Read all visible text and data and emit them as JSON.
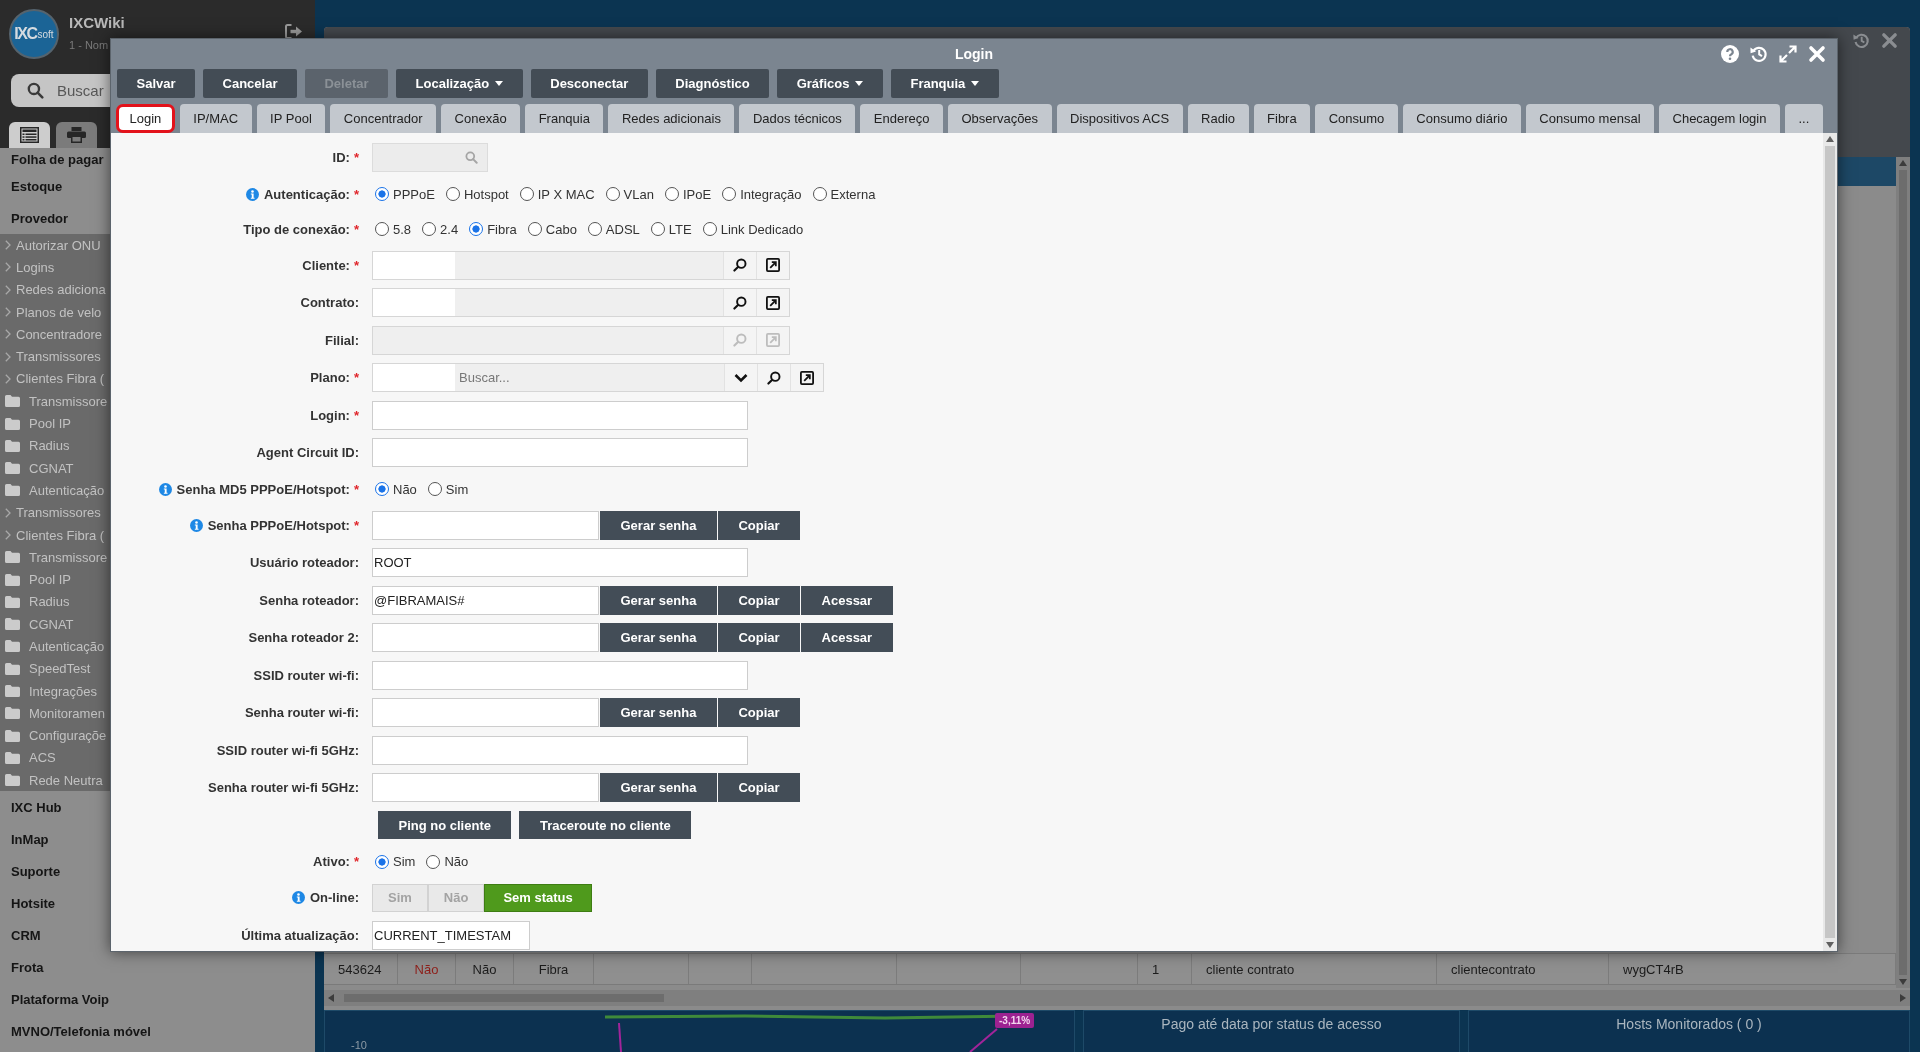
{
  "sidebar": {
    "logo": "**IXC**soft",
    "app_name": "IXCWiki",
    "user": "1 - Nom",
    "search": {
      "placeholder": "Buscar"
    },
    "tabs": [
      {
        "kind": "list",
        "selected": true
      },
      {
        "kind": "print",
        "selected": false
      }
    ],
    "menu": [
      {
        "kind": "section",
        "label": "Folha de pagar"
      },
      {
        "kind": "section",
        "label": "Estoque"
      },
      {
        "kind": "section",
        "label": "Provedor"
      },
      {
        "kind": "link",
        "label": "Autorizar ONU"
      },
      {
        "kind": "link",
        "label": "Logins"
      },
      {
        "kind": "link",
        "label": "Redes adiciona"
      },
      {
        "kind": "link",
        "label": "Planos de velo"
      },
      {
        "kind": "link",
        "label": "Concentradore"
      },
      {
        "kind": "link",
        "label": "Transmissores"
      },
      {
        "kind": "link",
        "label": "Clientes Fibra ("
      },
      {
        "kind": "folder",
        "label": "Transmissore"
      },
      {
        "kind": "folder",
        "label": "Pool IP"
      },
      {
        "kind": "folder",
        "label": "Radius"
      },
      {
        "kind": "folder",
        "label": "CGNAT"
      },
      {
        "kind": "folder",
        "label": "Autenticação"
      },
      {
        "kind": "link",
        "label": "Transmissores"
      },
      {
        "kind": "link",
        "label": "Clientes Fibra ("
      },
      {
        "kind": "folder",
        "label": "Transmissore"
      },
      {
        "kind": "folder",
        "label": "Pool IP"
      },
      {
        "kind": "folder",
        "label": "Radius"
      },
      {
        "kind": "folder",
        "label": "CGNAT"
      },
      {
        "kind": "folder",
        "label": "Autenticação"
      },
      {
        "kind": "folder",
        "label": "SpeedTest"
      },
      {
        "kind": "folder",
        "label": "Integrações"
      },
      {
        "kind": "folder",
        "label": "Monitoramen"
      },
      {
        "kind": "folder",
        "label": "Configuraçõe"
      },
      {
        "kind": "folder",
        "label": "ACS"
      },
      {
        "kind": "folder",
        "label": "Rede Neutra"
      },
      {
        "kind": "section",
        "label": "IXC Hub"
      },
      {
        "kind": "section",
        "label": "InMap"
      },
      {
        "kind": "section",
        "label": "Suporte"
      },
      {
        "kind": "section",
        "label": "Hotsite"
      },
      {
        "kind": "section",
        "label": "CRM"
      },
      {
        "kind": "section",
        "label": "Frota"
      },
      {
        "kind": "section",
        "label": "Plataforma Voip"
      },
      {
        "kind": "section",
        "label": "MVNO/Telefonia móvel"
      }
    ]
  },
  "workspace": {
    "grid": {
      "rows": [
        {
          "cells": [
            {
              "kind": "plain",
              "text": "543624"
            },
            {
              "kind": "negative",
              "text": "Não"
            },
            {
              "kind": "plain",
              "text": "Não"
            },
            {
              "kind": "plain",
              "text": "Fibra"
            },
            {
              "kind": "blank"
            },
            {
              "kind": "blank"
            },
            {
              "kind": "blank"
            },
            {
              "kind": "blank"
            },
            {
              "kind": "blank"
            },
            {
              "kind": "plain",
              "text": "1"
            },
            {
              "kind": "plain",
              "text": "cliente contrato"
            },
            {
              "kind": "plain",
              "text": "clientecontrato"
            },
            {
              "kind": "plain",
              "text": "wygCT4rB"
            }
          ]
        }
      ]
    },
    "dashboard": {
      "chart": {
        "tick": "-10",
        "value_label": "-3,11%"
      },
      "panels": [
        {
          "title": "Pago até data por status de acesso"
        },
        {
          "title": "Hosts Monitorados ( 0 )"
        }
      ]
    }
  },
  "dialog": {
    "title": "Login",
    "toolbar": [
      {
        "label": "Salvar",
        "disabled": false,
        "dropdown": false
      },
      {
        "label": "Cancelar",
        "disabled": false,
        "dropdown": false
      },
      {
        "label": "Deletar",
        "disabled": true,
        "dropdown": false
      },
      {
        "label": "Localização",
        "disabled": false,
        "dropdown": true
      },
      {
        "label": "Desconectar",
        "disabled": false,
        "dropdown": false
      },
      {
        "label": "Diagnóstico",
        "disabled": false,
        "dropdown": false
      },
      {
        "label": "Gráficos",
        "disabled": false,
        "dropdown": true
      },
      {
        "label": "Franquia",
        "disabled": false,
        "dropdown": true
      }
    ],
    "tabs": [
      {
        "label": "Login",
        "selected": true
      },
      {
        "label": "IP/MAC",
        "selected": false
      },
      {
        "label": "IP Pool",
        "selected": false
      },
      {
        "label": "Concentrador",
        "selected": false
      },
      {
        "label": "Conexão",
        "selected": false
      },
      {
        "label": "Franquia",
        "selected": false
      },
      {
        "label": "Redes adicionais",
        "selected": false
      },
      {
        "label": "Dados técnicos",
        "selected": false
      },
      {
        "label": "Endereço",
        "selected": false
      },
      {
        "label": "Observações",
        "selected": false
      },
      {
        "label": "Dispositivos ACS",
        "selected": false
      },
      {
        "label": "Radio",
        "selected": false
      },
      {
        "label": "Fibra",
        "selected": false
      },
      {
        "label": "Consumo",
        "selected": false
      },
      {
        "label": "Consumo diário",
        "selected": false
      },
      {
        "label": "Consumo mensal",
        "selected": false
      },
      {
        "label": "Checagem login",
        "selected": false
      },
      {
        "label": "...",
        "selected": false
      }
    ],
    "form": [
      {
        "kind": "id",
        "label": "ID:",
        "required_mark": "*",
        "info": false,
        "disabled": true
      },
      {
        "kind": "radio",
        "label": "Autenticação:",
        "required_mark": "*",
        "info": true,
        "options": [
          {
            "label": "PPPoE",
            "selected": true
          },
          {
            "label": "Hotspot",
            "selected": false
          },
          {
            "label": "IP X MAC",
            "selected": false
          },
          {
            "label": "VLan",
            "selected": false
          },
          {
            "label": "IPoE",
            "selected": false
          },
          {
            "label": "Integração",
            "selected": false
          },
          {
            "label": "Externa",
            "selected": false
          }
        ]
      },
      {
        "kind": "radio",
        "label": "Tipo de conexão:",
        "required_mark": "*",
        "info": false,
        "options": [
          {
            "label": "5.8",
            "selected": false
          },
          {
            "label": "2.4",
            "selected": false
          },
          {
            "label": "Fibra",
            "selected": true
          },
          {
            "label": "Cabo",
            "selected": false
          },
          {
            "label": "ADSL",
            "selected": false
          },
          {
            "label": "LTE",
            "selected": false
          },
          {
            "label": "Link Dedicado",
            "selected": false
          }
        ]
      },
      {
        "kind": "lookup",
        "label": "Cliente:",
        "required_mark": "*",
        "info": false,
        "disabled": false
      },
      {
        "kind": "lookup",
        "label": "Contrato:",
        "info": false,
        "disabled": false
      },
      {
        "kind": "lookup",
        "label": "Filial:",
        "info": false,
        "disabled": true
      },
      {
        "kind": "select",
        "label": "Plano:",
        "required_mark": "*",
        "info": false,
        "disabled": false,
        "placeholder": "Buscar..."
      },
      {
        "kind": "text",
        "label": "Login:",
        "required_mark": "*",
        "info": false,
        "disabled": false
      },
      {
        "kind": "text",
        "label": "Agent Circuit ID:",
        "info": false,
        "disabled": false
      },
      {
        "kind": "radio",
        "label": "Senha MD5 PPPoE/Hotspot:",
        "required_mark": "*",
        "info": true,
        "options": [
          {
            "label": "Não",
            "selected": true
          },
          {
            "label": "Sim",
            "selected": false
          }
        ]
      },
      {
        "kind": "text",
        "label": "Senha PPPoE/Hotspot:",
        "required_mark": "*",
        "info": true,
        "disabled": false,
        "buttons": [
          "Gerar senha",
          "Copiar"
        ]
      },
      {
        "kind": "text",
        "label": "Usuário roteador:",
        "info": false,
        "disabled": false,
        "value": "ROOT"
      },
      {
        "kind": "text",
        "label": "Senha roteador:",
        "info": false,
        "disabled": false,
        "value": "@FIBRAMAIS#",
        "buttons": [
          "Gerar senha",
          "Copiar",
          "Acessar"
        ]
      },
      {
        "kind": "text",
        "label": "Senha roteador 2:",
        "info": false,
        "disabled": false,
        "buttons": [
          "Gerar senha",
          "Copiar",
          "Acessar"
        ]
      },
      {
        "kind": "text",
        "label": "SSID router wi-fi:",
        "info": false,
        "disabled": false
      },
      {
        "kind": "text",
        "label": "Senha router wi-fi:",
        "info": false,
        "disabled": false,
        "buttons": [
          "Gerar senha",
          "Copiar"
        ]
      },
      {
        "kind": "text",
        "label": "SSID router wi-fi 5GHz:",
        "info": false,
        "disabled": false
      },
      {
        "kind": "text",
        "label": "Senha router wi-fi 5GHz:",
        "info": false,
        "disabled": false,
        "buttons": [
          "Gerar senha",
          "Copiar"
        ]
      },
      {
        "kind": "actions",
        "buttons": [
          "Ping no cliente",
          "Traceroute no cliente"
        ]
      },
      {
        "kind": "radio",
        "label": "Ativo:",
        "required_mark": "*",
        "info": false,
        "options": [
          {
            "label": "Sim",
            "selected": true
          },
          {
            "label": "Não",
            "selected": false
          }
        ]
      },
      {
        "kind": "segmented",
        "label": "On-line:",
        "info": true,
        "options": [
          {
            "label": "Sim",
            "selected": false,
            "disabled": true
          },
          {
            "label": "Não",
            "selected": false,
            "disabled": true
          },
          {
            "label": "Sem status",
            "selected": true,
            "disabled": false
          }
        ]
      },
      {
        "kind": "timestamp",
        "label": "Última atualização:",
        "info": false,
        "disabled": false,
        "value": "CURRENT_TIMESTAM"
      }
    ]
  }
}
